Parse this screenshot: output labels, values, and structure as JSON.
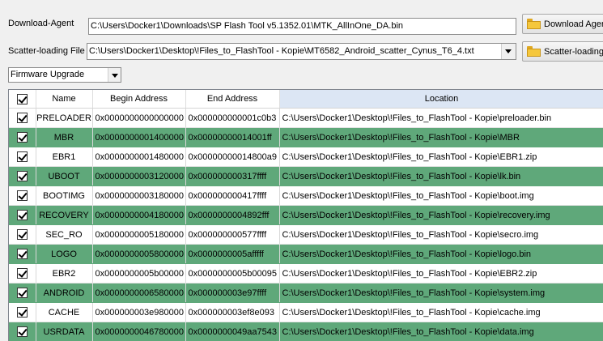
{
  "download_agent": {
    "label": "Download-Agent",
    "path": "C:\\Users\\Docker1\\Downloads\\SP Flash Tool v5.1352.01\\MTK_AllInOne_DA.bin",
    "button_label": "Download Agent"
  },
  "scatter": {
    "label": "Scatter-loading File",
    "path": "C:\\Users\\Docker1\\Desktop\\!Files_to_FlashTool - Kopie\\MT6582_Android_scatter_Cynus_T6_4.txt",
    "button_label": "Scatter-loading"
  },
  "mode_select": {
    "value": "Firmware Upgrade"
  },
  "table": {
    "columns": [
      "Name",
      "Begin Address",
      "End Address",
      "Location"
    ],
    "rows": [
      {
        "name": "PRELOADER",
        "begin": "0x0000000000000000",
        "end": "0x000000000001c0b3",
        "location": "C:\\Users\\Docker1\\Desktop\\!Files_to_FlashTool - Kopie\\preloader.bin",
        "checked": true,
        "highlight": false
      },
      {
        "name": "MBR",
        "begin": "0x0000000001400000",
        "end": "0x00000000014001ff",
        "location": "C:\\Users\\Docker1\\Desktop\\!Files_to_FlashTool - Kopie\\MBR",
        "checked": true,
        "highlight": true
      },
      {
        "name": "EBR1",
        "begin": "0x0000000001480000",
        "end": "0x00000000014800a9",
        "location": "C:\\Users\\Docker1\\Desktop\\!Files_to_FlashTool - Kopie\\EBR1.zip",
        "checked": true,
        "highlight": false
      },
      {
        "name": "UBOOT",
        "begin": "0x0000000003120000",
        "end": "0x000000000317ffff",
        "location": "C:\\Users\\Docker1\\Desktop\\!Files_to_FlashTool - Kopie\\lk.bin",
        "checked": true,
        "highlight": true
      },
      {
        "name": "BOOTIMG",
        "begin": "0x0000000003180000",
        "end": "0x000000000417ffff",
        "location": "C:\\Users\\Docker1\\Desktop\\!Files_to_FlashTool - Kopie\\boot.img",
        "checked": true,
        "highlight": false
      },
      {
        "name": "RECOVERY",
        "begin": "0x0000000004180000",
        "end": "0x0000000004892fff",
        "location": "C:\\Users\\Docker1\\Desktop\\!Files_to_FlashTool - Kopie\\recovery.img",
        "checked": true,
        "highlight": true
      },
      {
        "name": "SEC_RO",
        "begin": "0x0000000005180000",
        "end": "0x000000000577ffff",
        "location": "C:\\Users\\Docker1\\Desktop\\!Files_to_FlashTool - Kopie\\secro.img",
        "checked": true,
        "highlight": false
      },
      {
        "name": "LOGO",
        "begin": "0x0000000005800000",
        "end": "0x0000000005afffff",
        "location": "C:\\Users\\Docker1\\Desktop\\!Files_to_FlashTool - Kopie\\logo.bin",
        "checked": true,
        "highlight": true
      },
      {
        "name": "EBR2",
        "begin": "0x0000000005b00000",
        "end": "0x0000000005b00095",
        "location": "C:\\Users\\Docker1\\Desktop\\!Files_to_FlashTool - Kopie\\EBR2.zip",
        "checked": true,
        "highlight": false
      },
      {
        "name": "ANDROID",
        "begin": "0x0000000006580000",
        "end": "0x000000003e97ffff",
        "location": "C:\\Users\\Docker1\\Desktop\\!Files_to_FlashTool - Kopie\\system.img",
        "checked": true,
        "highlight": true
      },
      {
        "name": "CACHE",
        "begin": "0x000000003e980000",
        "end": "0x000000003ef8e093",
        "location": "C:\\Users\\Docker1\\Desktop\\!Files_to_FlashTool - Kopie\\cache.img",
        "checked": true,
        "highlight": false
      },
      {
        "name": "USRDATA",
        "begin": "0x0000000046780000",
        "end": "0x0000000049aa7543",
        "location": "C:\\Users\\Docker1\\Desktop\\!Files_to_FlashTool - Kopie\\data.img",
        "checked": true,
        "highlight": true
      }
    ]
  },
  "colors": {
    "highlight_row": "#5fa87a",
    "location_header": "#dce6f4"
  },
  "icons": {
    "folder": "folder-icon",
    "check": "checkbox-checked-icon",
    "dropdown": "chevron-down-icon"
  }
}
